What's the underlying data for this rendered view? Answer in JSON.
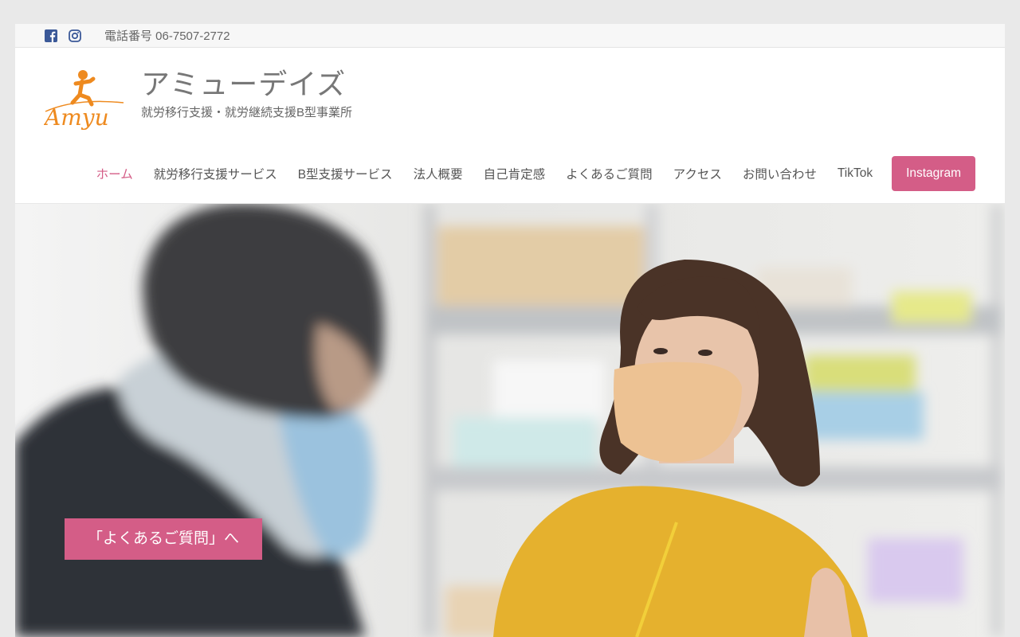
{
  "topbar": {
    "facebook_icon": "facebook-icon",
    "instagram_icon": "instagram-icon",
    "phone": "電話番号 06-7507-2772"
  },
  "brand": {
    "logo_text": "Amyu",
    "title": "アミューデイズ",
    "tagline": "就労移行支援・就労継続支援B型事業所"
  },
  "nav": {
    "items": [
      {
        "label": "ホーム",
        "active": true
      },
      {
        "label": "就労移行支援サービス"
      },
      {
        "label": "B型支援サービス"
      },
      {
        "label": "法人概要"
      },
      {
        "label": "自己肯定感"
      },
      {
        "label": "よくあるご質問"
      },
      {
        "label": "アクセス"
      },
      {
        "label": "お問い合わせ"
      },
      {
        "label": "TikTok"
      }
    ],
    "cta": "Instagram"
  },
  "hero": {
    "button": "「よくあるご質問」へ"
  },
  "colors": {
    "accent": "#d45d87",
    "logo_orange": "#ee8a1f",
    "facebook": "#3b5998",
    "instagram": "#3b5998"
  }
}
